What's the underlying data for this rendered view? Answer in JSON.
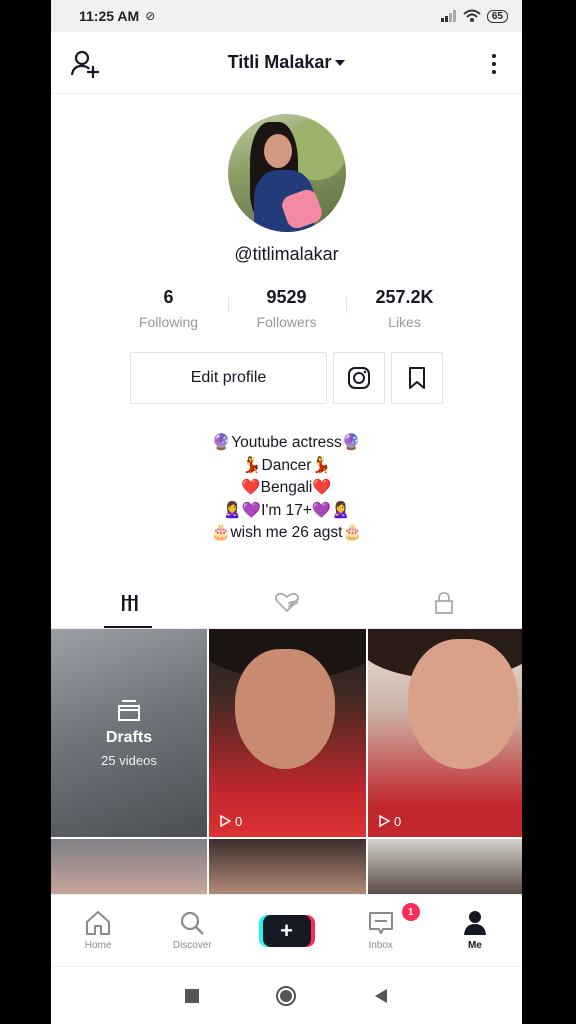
{
  "status_bar": {
    "time": "11:25 AM",
    "battery": "65"
  },
  "header": {
    "title": "Titli Malakar"
  },
  "profile": {
    "username": "@titlimalakar",
    "stats": [
      {
        "value": "6",
        "label": "Following"
      },
      {
        "value": "9529",
        "label": "Followers"
      },
      {
        "value": "257.2K",
        "label": "Likes"
      }
    ],
    "edit_profile_label": "Edit profile",
    "bio": [
      "🔮Youtube actress🔮",
      "💃Dancer💃",
      "❤️Bengali❤️",
      "🙎‍♀️💜I'm 17+💜🙎‍♀️",
      "🎂wish me 26 agst🎂"
    ]
  },
  "tabs": [
    "videos-grid",
    "liked",
    "private"
  ],
  "grid": {
    "drafts_label": "Drafts",
    "drafts_count": "25 videos",
    "video_views": [
      "0",
      "0"
    ]
  },
  "bottom_nav": {
    "items": [
      {
        "label": "Home"
      },
      {
        "label": "Discover"
      },
      {
        "label": ""
      },
      {
        "label": "Inbox",
        "badge": "1"
      },
      {
        "label": "Me"
      }
    ]
  },
  "colors": {
    "accent": "#fe2c55",
    "cyan": "#25f4ee",
    "text": "#161823"
  }
}
